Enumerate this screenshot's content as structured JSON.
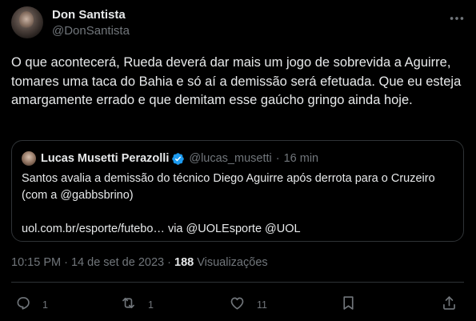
{
  "author": {
    "display_name": "Don Santista",
    "handle": "@DonSantista"
  },
  "tweet": {
    "text": "O que acontecerá, Rueda deverá dar mais um jogo de sobrevida a Aguirre, tomares uma taca do Bahia e só aí a demissão será efetuada. Que eu esteja amargamente errado e que demitam esse gaúcho gringo ainda hoje."
  },
  "quote": {
    "display_name": "Lucas Musetti Perazolli",
    "handle": "@lucas_musetti",
    "separator": "·",
    "time": "16 min",
    "text": "Santos avalia a demissão do técnico Diego Aguirre após derrota para o Cruzeiro (com a @gabbsbrino)\n\nuol.com.br/esporte/futebo… via @UOLEsporte @UOL"
  },
  "meta": {
    "time": "10:15 PM",
    "separator": "·",
    "date": "14 de set de 2023",
    "views_count": "188",
    "views_label": "Visualizações"
  },
  "actions": {
    "reply_count": "1",
    "retweet_count": "1",
    "like_count": "11"
  },
  "icons": {
    "more": "more-horizontal-icon",
    "verified": "verified-badge-icon",
    "reply": "reply-icon",
    "retweet": "retweet-icon",
    "like": "heart-icon",
    "bookmark": "bookmark-icon",
    "share": "share-icon"
  },
  "colors": {
    "background": "#000000",
    "text": "#e7e9ea",
    "secondary_text": "#71767b",
    "border": "#2f3336",
    "verified": "#1d9bf0"
  }
}
